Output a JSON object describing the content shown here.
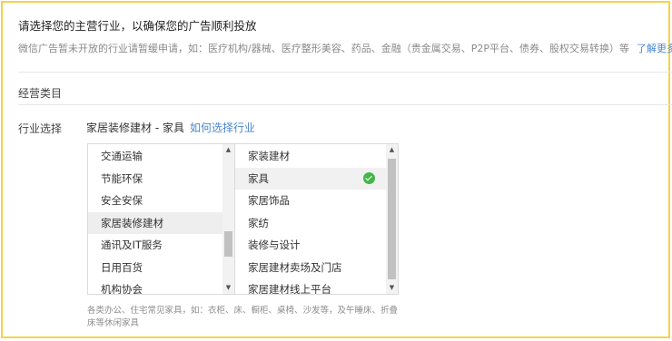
{
  "header": {
    "title": "请选择您的主营行业，以确保您的广告顺利投放",
    "notice": "微信广告暂未开放的行业请暂缓申请，如：医疗机构/器械、医疗整形美容、药品、金融（贵金属交易、P2P平台、债券、股权交易转换）等",
    "learn_more": "了解更多"
  },
  "section": {
    "title": "经营类目"
  },
  "industry": {
    "label": "行业选择",
    "selected_path": "家居装修建材 - 家具",
    "how_to_link": "如何选择行业"
  },
  "left_list": {
    "items": [
      "交通运输",
      "节能环保",
      "安全安保",
      "家居装修建材",
      "通讯及IT服务",
      "日用百货",
      "机构协会"
    ],
    "active": "家居装修建材"
  },
  "right_list": {
    "items": [
      "家装建材",
      "家具",
      "家居饰品",
      "家纺",
      "装修与设计",
      "家居建材卖场及门店",
      "家居建材线上平台"
    ],
    "selected": "家具"
  },
  "help_text": "各类办公、住宅常见家具，如：衣柜、床、橱柜、桌椅、沙发等，及午睡床、折叠床等休闲家具",
  "icons": {
    "check": "check-circle-icon",
    "scroll_up": "arrow-up-icon",
    "scroll_down": "arrow-down-icon"
  },
  "colors": {
    "accent": "#4a86cf",
    "check": "#44b549",
    "frame": "#f6d24a"
  }
}
